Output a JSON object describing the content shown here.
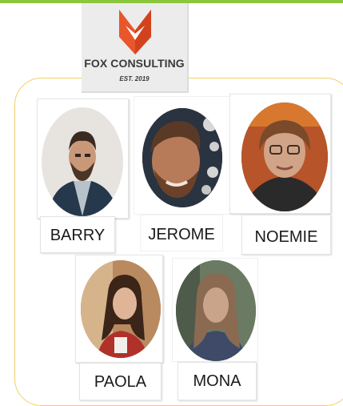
{
  "logo": {
    "name": "FOX CONSULTING",
    "established": "EST. 2019",
    "icon": "fox-icon",
    "colors": {
      "orange": "#e8562a",
      "dark_orange": "#d2431d"
    }
  },
  "team": [
    {
      "name": "BARRY"
    },
    {
      "name": "JEROME"
    },
    {
      "name": "NOEMIE"
    },
    {
      "name": "PAOLA"
    },
    {
      "name": "MONA"
    }
  ],
  "colors": {
    "accent_bar": "#8cc63f",
    "frame_border": "#f1cf6c"
  }
}
